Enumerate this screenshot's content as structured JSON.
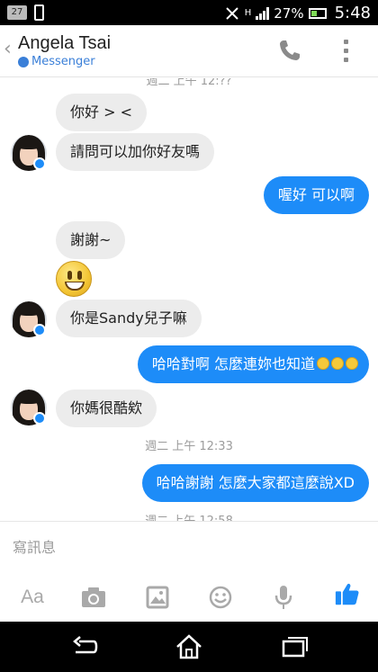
{
  "status_bar": {
    "notification_badge": "27",
    "battery_percent": "27%",
    "time": "5:48",
    "signal_label": "H"
  },
  "header": {
    "contact_name": "Angela Tsai",
    "subtitle": "Messenger"
  },
  "messages": [
    {
      "side": "in",
      "text": "你好 >  <"
    },
    {
      "side": "in",
      "text": "請問可以加你好友嗎"
    },
    {
      "side": "out",
      "text": "喔好 可以啊"
    },
    {
      "side": "in",
      "text": "謝謝~"
    },
    {
      "side": "in",
      "emoji": "grinning-face"
    },
    {
      "side": "in",
      "text": "你是Sandy兒子嘛"
    },
    {
      "side": "out",
      "text": "哈哈對啊 怎麼連妳也知道",
      "trailing_emoji": [
        "laughing-tears",
        "laughing-tears",
        "laughing-tears"
      ]
    },
    {
      "side": "in",
      "text": "你媽很酷欸"
    },
    {
      "side": "out",
      "text": "哈哈謝謝 怎麼大家都這麼說XD"
    }
  ],
  "timestamps": {
    "top_cutoff": "週二 上午 12:??",
    "mid": "週二 上午 12:33",
    "bottom": "週二 上午 12:58"
  },
  "composer": {
    "placeholder": "寫訊息",
    "text_tool_label": "Aa",
    "icons": [
      "text-format-icon",
      "camera-icon",
      "gallery-icon",
      "emoji-icon",
      "microphone-icon",
      "thumbs-up-icon"
    ]
  },
  "colors": {
    "accent": "#1d8cf8",
    "incoming_bubble": "#ececec",
    "timestamp": "#9c9c9c"
  }
}
